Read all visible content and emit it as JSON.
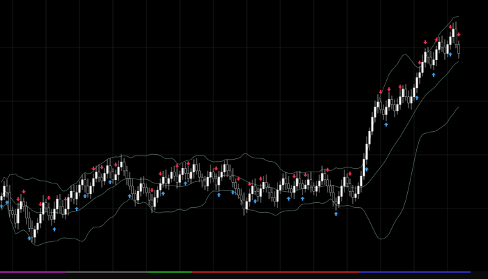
{
  "chart_data": {
    "type": "candlestick",
    "title": "",
    "xlabel": "",
    "ylabel": "",
    "grid": true,
    "legend": "none",
    "colors": {
      "background": "#000000",
      "bull_body": "#ffffff",
      "bear_body": "#000000",
      "wick": "#c8c8c8",
      "bands": "#4f6b5f",
      "grid": "#2a2a2a",
      "sell_arrow": "#e0304e",
      "buy_arrow": "#3a9ae8"
    },
    "ylim": [
      0,
      400
    ],
    "x": [
      1,
      2,
      3,
      4,
      5,
      6,
      7,
      8,
      9,
      10,
      11,
      12,
      13,
      14,
      15,
      16,
      17,
      18,
      19,
      20,
      21,
      22,
      23,
      24,
      25,
      26,
      27,
      28,
      29,
      30,
      31,
      32,
      33,
      34,
      35,
      36,
      37,
      38,
      39,
      40,
      41,
      42,
      43,
      44,
      45,
      46,
      47,
      48,
      49,
      50,
      51,
      52,
      53,
      54,
      55,
      56,
      57,
      58,
      59,
      60,
      61,
      62,
      63,
      64,
      65,
      66,
      67,
      68,
      69,
      70,
      71,
      72,
      73,
      74,
      75,
      76,
      77,
      78,
      79,
      80,
      81,
      82,
      83,
      84,
      85,
      86,
      87,
      88,
      89,
      90,
      91,
      92,
      93,
      94,
      95,
      96,
      97,
      98,
      99,
      100,
      101,
      102,
      103,
      104,
      105,
      106,
      107,
      108,
      109,
      110,
      111,
      112,
      113,
      114,
      115,
      116,
      117,
      118,
      119,
      120,
      121,
      122,
      123,
      124,
      125,
      126,
      127,
      128,
      129,
      130,
      131,
      132,
      133,
      134,
      135,
      136,
      137,
      138,
      139,
      140,
      141,
      142,
      143,
      144,
      145,
      146,
      147,
      148,
      149,
      150,
      151,
      152,
      153,
      154,
      155,
      156,
      157,
      158,
      159,
      160,
      161,
      162,
      163,
      164,
      165
    ],
    "close": [
      112,
      128,
      118,
      90,
      84,
      70,
      92,
      104,
      96,
      78,
      62,
      48,
      60,
      70,
      84,
      102,
      94,
      82,
      76,
      92,
      108,
      96,
      84,
      92,
      110,
      120,
      108,
      118,
      130,
      138,
      128,
      116,
      128,
      140,
      150,
      142,
      136,
      148,
      160,
      150,
      138,
      146,
      158,
      166,
      152,
      140,
      128,
      116,
      106,
      120,
      132,
      126,
      118,
      106,
      96,
      110,
      122,
      132,
      142,
      132,
      140,
      150,
      144,
      134,
      146,
      156,
      148,
      140,
      150,
      162,
      152,
      142,
      136,
      128,
      142,
      150,
      140,
      130,
      142,
      150,
      162,
      152,
      144,
      134,
      124,
      114,
      106,
      92,
      104,
      116,
      128,
      120,
      112,
      124,
      134,
      126,
      118,
      110,
      104,
      122,
      130,
      140,
      132,
      124,
      118,
      128,
      140,
      132,
      124,
      130,
      138,
      128,
      120,
      128,
      136,
      148,
      138,
      128,
      118,
      104,
      100,
      112,
      128,
      142,
      132,
      120,
      110,
      116,
      128,
      144,
      170,
      194,
      214,
      236,
      252,
      260,
      248,
      240,
      252,
      264,
      256,
      246,
      256,
      268,
      280,
      268,
      258,
      268,
      282,
      298,
      306,
      322,
      338,
      330,
      318,
      326,
      342,
      354,
      346,
      336,
      350,
      362,
      374,
      350,
      336
    ],
    "sell_signals": [
      7,
      9,
      15,
      18,
      24,
      34,
      37,
      42,
      55,
      58,
      64,
      68,
      78,
      86,
      90,
      94,
      106,
      110,
      118,
      126,
      137,
      140,
      144,
      151,
      153,
      157,
      162,
      166
    ],
    "buy_signals": [
      1,
      3,
      11,
      20,
      28,
      31,
      40,
      47,
      59,
      67,
      79,
      84,
      92,
      104,
      109,
      121,
      132,
      139,
      150,
      156,
      162
    ]
  }
}
